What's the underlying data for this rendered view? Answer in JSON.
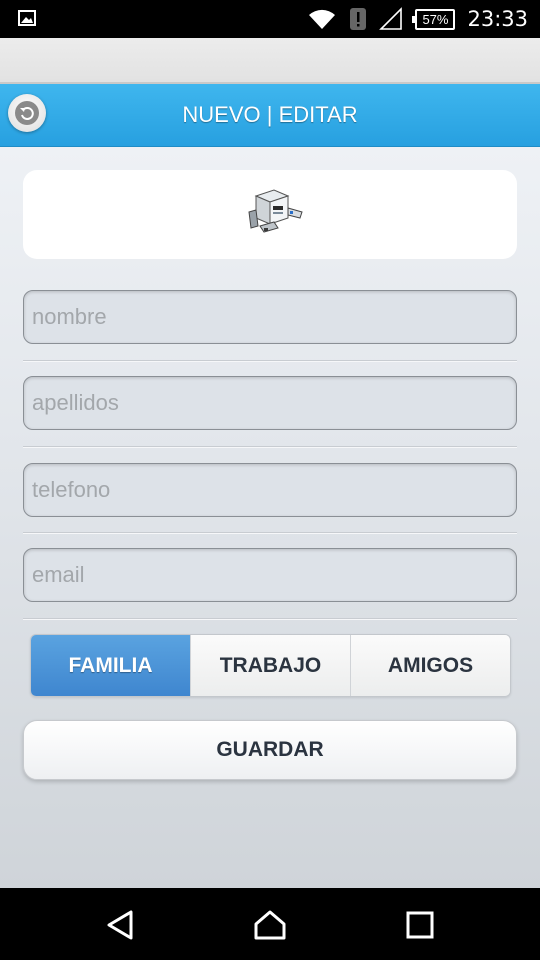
{
  "status_bar": {
    "battery": "57%",
    "time": "23:33",
    "icons": [
      "image-icon",
      "wifi-icon",
      "alert-icon",
      "signal-icon",
      "battery-icon"
    ]
  },
  "header": {
    "title": "NUEVO | EDITAR",
    "back_icon": "back-arrow-icon",
    "accent_color": "#2aa6e6"
  },
  "photo": {
    "icon": "fax-machine-icon"
  },
  "form": {
    "nombre_placeholder": "nombre",
    "apellidos_placeholder": "apellidos",
    "telefono_placeholder": "telefono",
    "email_placeholder": "email",
    "nombre_value": "",
    "apellidos_value": "",
    "telefono_value": "",
    "email_value": ""
  },
  "groups": {
    "options": [
      "FAMILIA",
      "TRABAJO",
      "AMIGOS"
    ],
    "selected": "FAMILIA",
    "active_color": "#4a93d6"
  },
  "save": {
    "label": "GUARDAR"
  },
  "nav_bar": {
    "icons": [
      "back-triangle-icon",
      "home-icon",
      "recents-square-icon"
    ]
  }
}
